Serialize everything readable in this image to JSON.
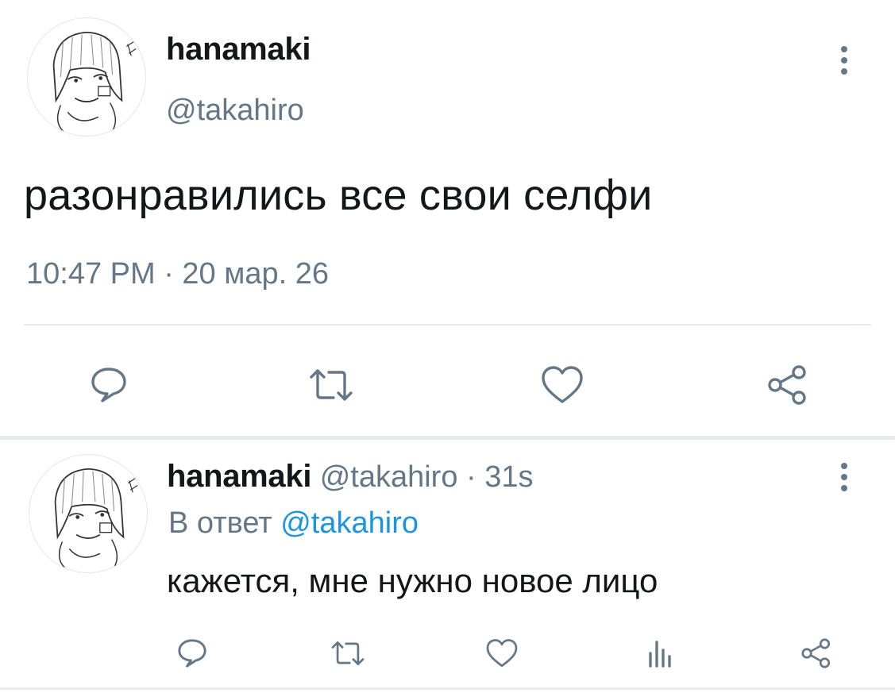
{
  "main_tweet": {
    "display_name": "hanamaki",
    "handle": "@takahiro",
    "text": "разонравились все свои селфи",
    "meta": "10:47 PM · 20 мар. 26",
    "avatar_icon": "manga-avatar",
    "actions": [
      "reply-icon",
      "retweet-icon",
      "like-icon",
      "share-icon"
    ]
  },
  "reply_tweet": {
    "display_name": "hanamaki",
    "handle": "@takahiro",
    "time": "· 31s",
    "reply_to_prefix": "В ответ",
    "reply_to_handle": "@takahiro",
    "text": "кажется, мне нужно новое лицо",
    "avatar_icon": "manga-avatar",
    "actions": [
      "reply-icon",
      "retweet-icon",
      "like-icon",
      "stats-icon",
      "share-icon"
    ]
  },
  "colors": {
    "text_primary": "#14171a",
    "text_secondary": "#657786",
    "link": "#1b95e0",
    "divider": "#e6ecf0"
  }
}
